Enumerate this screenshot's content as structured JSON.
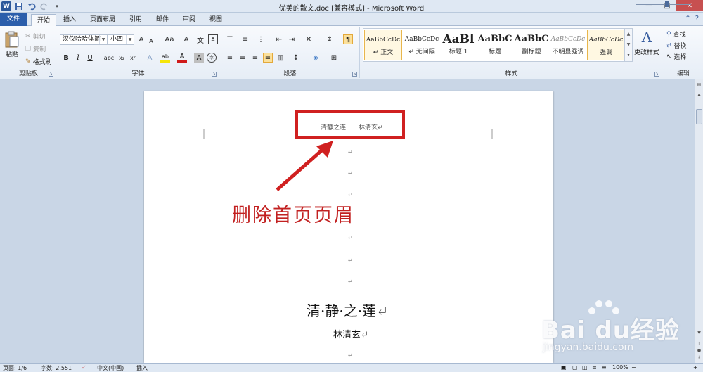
{
  "window": {
    "title": "优美的散文.doc [兼容模式] - Microsoft Word",
    "app_icon": "W",
    "controls": {
      "minimize": "—",
      "maximize": "□",
      "close": "✕"
    }
  },
  "tabs": [
    "文件",
    "开始",
    "插入",
    "页面布局",
    "引用",
    "邮件",
    "审阅",
    "视图"
  ],
  "active_tab": "开始",
  "ribbon": {
    "clipboard": {
      "label": "剪贴板",
      "paste": "粘贴",
      "cut": "剪切",
      "copy": "复制",
      "format_painter": "格式刷"
    },
    "font": {
      "label": "字体",
      "font_name": "汉仪哈哈体简",
      "font_size": "小四",
      "bold": "B",
      "italic": "I",
      "underline": "U",
      "strike": "abc",
      "subscript": "x₂",
      "superscript": "x²",
      "grow": "A",
      "shrink": "A",
      "change_case": "Aa",
      "clear": "A",
      "highlight": "ab",
      "font_color": "A",
      "char_shading": "A",
      "enclose": "字"
    },
    "paragraph": {
      "label": "段落"
    },
    "styles": {
      "label": "样式",
      "items": [
        {
          "preview": "AaBbCcDc",
          "name": "↵ 正文"
        },
        {
          "preview": "AaBbCcDc",
          "name": "↵ 无间隔"
        },
        {
          "preview": "AaBl",
          "name": "标题 1"
        },
        {
          "preview": "AaBbC",
          "name": "标题"
        },
        {
          "preview": "AaBbC",
          "name": "副标题"
        },
        {
          "preview": "AaBbCcDc",
          "name": "不明显强调"
        },
        {
          "preview": "AaBbCcDc",
          "name": "强调"
        }
      ],
      "change_styles": "更改样式"
    },
    "editing": {
      "label": "编辑",
      "find": "查找",
      "replace": "替换",
      "select": "选择"
    }
  },
  "document": {
    "header_text": "清静之连一一林清玄↵",
    "annotation": "删除首页页眉",
    "title": "清·静·之·莲↵",
    "author": "林清玄↵",
    "para_mark": "↵"
  },
  "watermark": {
    "main": "Bai du经验",
    "sub": "jingyan.baidu.com"
  },
  "status": {
    "page": "页面: 1/6",
    "words": "字数: 2,551",
    "language": "中文(中国)",
    "mode": "插入",
    "zoom": "100%"
  },
  "colors": {
    "accent": "#2b579a",
    "annotation_red": "#c22020",
    "box_red": "#d02020"
  }
}
